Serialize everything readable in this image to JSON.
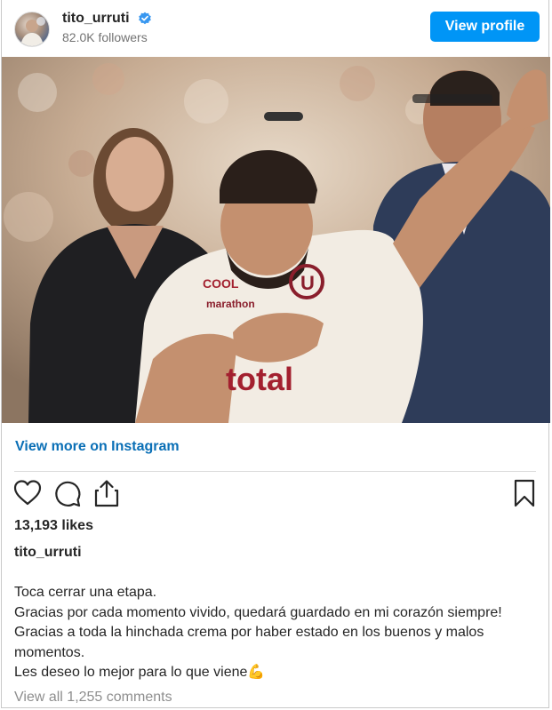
{
  "header": {
    "username": "tito_urruti",
    "followers": "82.0K followers",
    "view_profile_label": "View profile"
  },
  "post": {
    "view_more_label": "View more on Instagram",
    "likes": "13,193 likes",
    "caption_username": "tito_urruti",
    "caption_lines": [
      "Toca cerrar una etapa.",
      "Gracias por cada momento vivido, quedará guardado en mi corazón siempre!",
      "Gracias a toda la hinchada crema por haber estado en los buenos y malos",
      "momentos.",
      "Les deseo lo mejor para lo que viene"
    ],
    "caption_emoji": "💪",
    "view_comments_label": "View all 1,255 comments"
  },
  "photo_text": {
    "sponsor_1": "COOL",
    "sponsor_2": "marathon",
    "sponsor_3": "total"
  },
  "colors": {
    "accent": "#0095f6",
    "link": "#0a6fb6",
    "muted": "#737373",
    "divider": "#dbdbdb"
  },
  "icons": [
    "verified-badge-icon",
    "heart-icon",
    "comment-icon",
    "share-icon",
    "bookmark-icon"
  ]
}
